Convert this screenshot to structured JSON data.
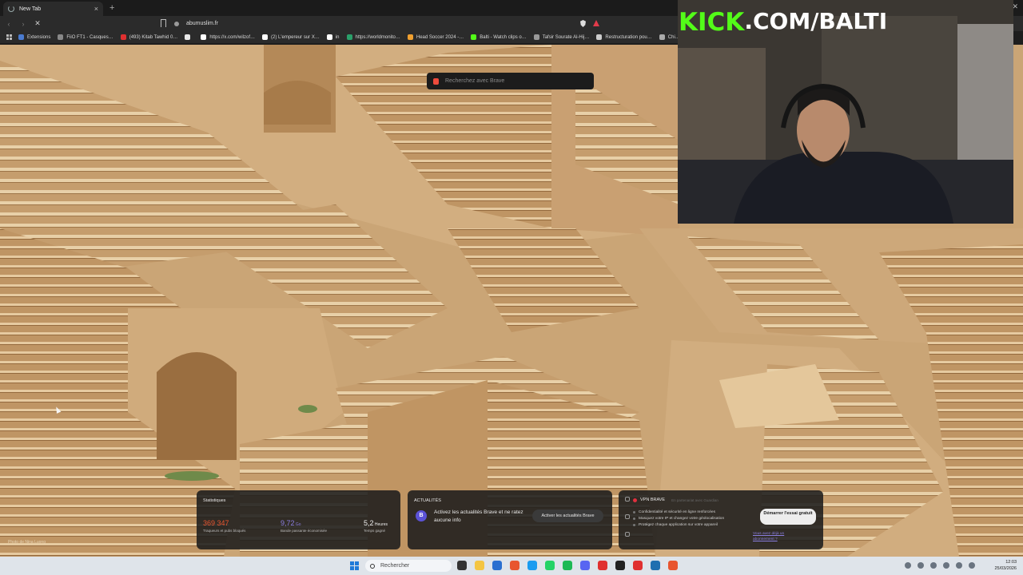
{
  "browser": {
    "tab": {
      "title": "New Tab",
      "close": "×",
      "new_tab": "+"
    },
    "window_controls": [
      "–",
      "▢",
      "✕"
    ],
    "address": {
      "url": "abumuslim.fr"
    },
    "bookmarks": [
      {
        "label": "Extensions",
        "color": "#4a7bd0"
      },
      {
        "label": "FiiO FT1 - Casques…",
        "color": "#888888"
      },
      {
        "label": "(493) Kitab Tawhid 0…",
        "color": "#e03030"
      },
      {
        "label": "",
        "color": "#e8e8e8"
      },
      {
        "label": "https://x.com/wilzof…",
        "color": "#ffffff"
      },
      {
        "label": "(2) L'empereur sur X…",
        "color": "#ffffff"
      },
      {
        "label": "in",
        "color": "#ffffff"
      },
      {
        "label": "https://worldmonito…",
        "color": "#2aa06a"
      },
      {
        "label": "Head Soccer 2024 -…",
        "color": "#f0a030"
      },
      {
        "label": "Balti - Watch clips o…",
        "color": "#53fc18"
      },
      {
        "label": "Tafsir Sourate Al-Hij…",
        "color": "#999999"
      },
      {
        "label": "Restructuration pou…",
        "color": "#cccccc"
      },
      {
        "label": "Chi…",
        "color": "#aaaaaa"
      }
    ]
  },
  "search_pill": {
    "placeholder": "Recherchez avec Brave"
  },
  "stream_overlay": {
    "brand_kick": "KICK",
    "brand_rest": ".COM/BALTI"
  },
  "photo_credit": "Photo de Nina Luong",
  "widgets": {
    "stats": {
      "title": "Statistiques",
      "items": [
        {
          "value": "369 347",
          "unit": "",
          "label": "Traqueurs et pubs bloqués",
          "color": "#e8552f"
        },
        {
          "value": "9,72",
          "unit": " Go",
          "label": "Bande passante économisée",
          "color": "#8a7ee0"
        },
        {
          "value": "5,2",
          "unit": " Heures",
          "label": "Temps gagné",
          "color": "#f0f0f0"
        }
      ]
    },
    "news": {
      "title": "ACTUALITÉS",
      "icon": "B",
      "text": "Activez les actualités Brave et ne ratez aucune info",
      "button": "Activer les actualités Brave"
    },
    "vpn": {
      "title": "VPN BRAVE",
      "subtitle": "En partenariat avec Guardian",
      "features": [
        "Confidentialité et sécurité en ligne renforcées",
        "Masquez votre IP et changez votre géolocalisation",
        "Protégez chaque application sur votre appareil"
      ],
      "button": "Démarrer l'essai gratuit",
      "link": "Vous avez déjà un abonnement ?"
    }
  },
  "taskbar": {
    "search_placeholder": "Rechercher",
    "apps": [
      "#333333",
      "#f4c542",
      "#2a6fd0",
      "#e8552f",
      "#1a9cf0",
      "#25d366",
      "#1db954",
      "#5865f2",
      "#e03030",
      "#222222",
      "#e03030",
      "#1f6fb0",
      "#e8552f"
    ],
    "clock_time": "12:03",
    "clock_date": "25/03/2026"
  }
}
